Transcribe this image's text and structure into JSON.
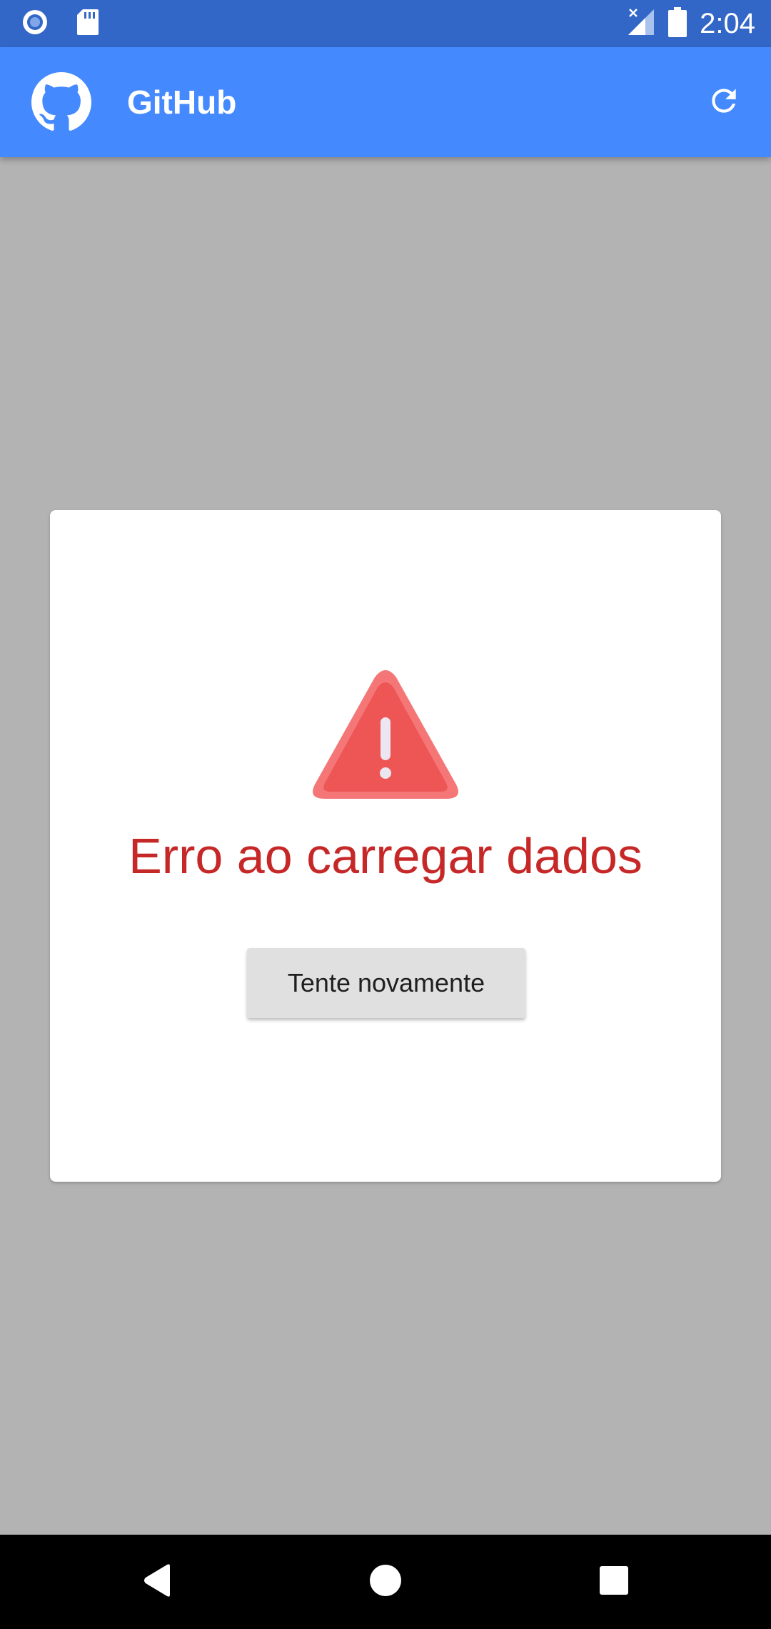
{
  "status_bar": {
    "time": "2:04",
    "left_icons": [
      "record-icon",
      "sd-card-icon"
    ],
    "right_icons": [
      "signal-no-data-icon",
      "battery-icon"
    ]
  },
  "app_bar": {
    "title": "GitHub",
    "logo_icon": "github-logo-icon",
    "action_icon": "refresh-icon",
    "color": "#448afe"
  },
  "error_card": {
    "icon": "warning-triangle-icon",
    "message": "Erro ao carregar dados",
    "retry_label": "Tente novamente",
    "message_color": "#c62828",
    "icon_color": "#f05a5a"
  },
  "nav_bar": {
    "buttons": [
      "back-icon",
      "home-icon",
      "recents-icon"
    ]
  }
}
